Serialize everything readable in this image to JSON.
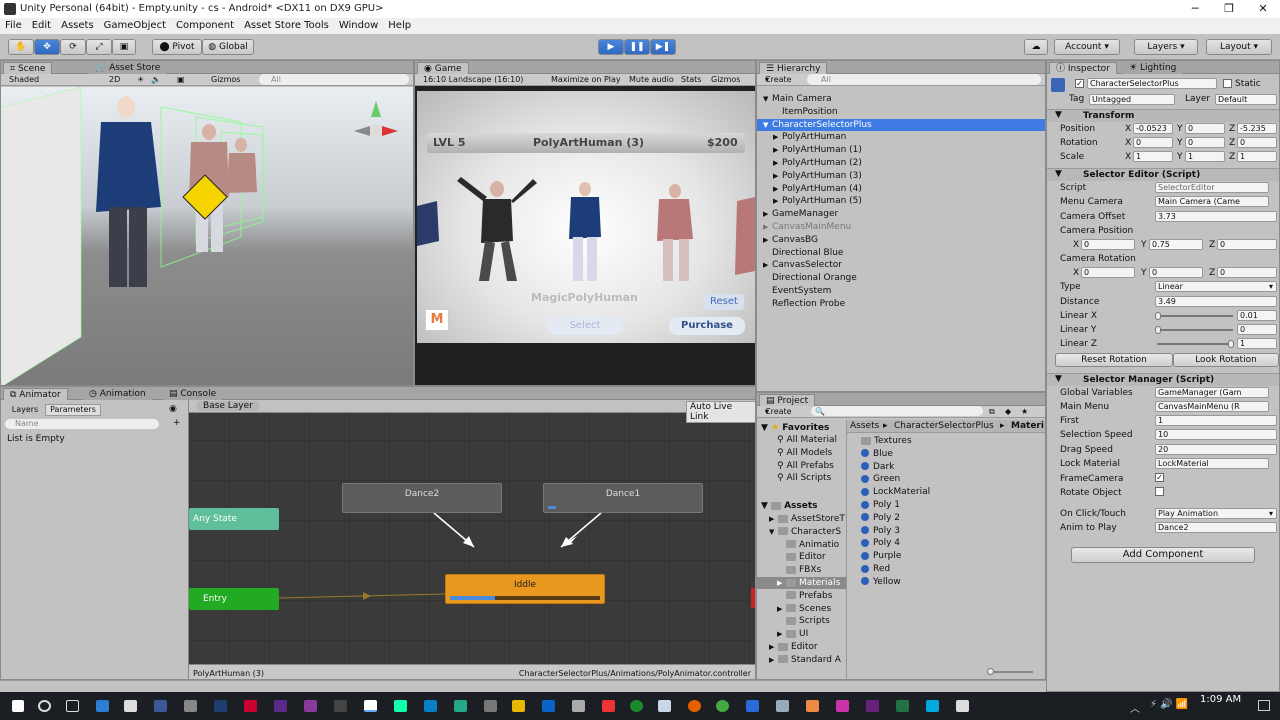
{
  "window": {
    "title": "Unity Personal (64bit) - Empty.unity - cs - Android* <DX11 on DX9 GPU>"
  },
  "menu": [
    "File",
    "Edit",
    "Assets",
    "GameObject",
    "Component",
    "Asset Store Tools",
    "Window",
    "Help"
  ],
  "toolbar": {
    "pivot": "Pivot",
    "global": "Global",
    "account": "Account",
    "layers": "Layers",
    "layout": "Layout"
  },
  "scene": {
    "tab": "Scene",
    "tab2": "Asset Store",
    "shading": "Shaded",
    "mode2d": "2D",
    "gizmos": "Gizmos",
    "search": "All"
  },
  "game": {
    "tab": "Game",
    "aspect": "16:10 Landscape (16:10)",
    "maximize": "Maximize on Play",
    "mute": "Mute audio",
    "stats": "Stats",
    "gizmos": "Gizmos",
    "lvl": "LVL 5",
    "char_name": "PolyArtHuman (3)",
    "money": "$200",
    "brand": "MagicPolyHuman",
    "reset": "Reset",
    "select": "Select",
    "purchase": "Purchase",
    "logo": "M"
  },
  "hierarchy": {
    "tab": "Hierarchy",
    "create": "Create",
    "search": "All",
    "items": [
      {
        "label": "Main Camera",
        "indent": 0,
        "arrow": "▼"
      },
      {
        "label": "ItemPosition",
        "indent": 1,
        "arrow": ""
      },
      {
        "label": "CharacterSelectorPlus",
        "indent": 0,
        "arrow": "▼",
        "selected": true
      },
      {
        "label": "PolyArtHuman",
        "indent": 1,
        "arrow": "▶"
      },
      {
        "label": "PolyArtHuman (1)",
        "indent": 1,
        "arrow": "▶"
      },
      {
        "label": "PolyArtHuman (2)",
        "indent": 1,
        "arrow": "▶"
      },
      {
        "label": "PolyArtHuman (3)",
        "indent": 1,
        "arrow": "▶"
      },
      {
        "label": "PolyArtHuman (4)",
        "indent": 1,
        "arrow": "▶"
      },
      {
        "label": "PolyArtHuman (5)",
        "indent": 1,
        "arrow": "▶"
      },
      {
        "label": "GameManager",
        "indent": 0,
        "arrow": "▶"
      },
      {
        "label": "CanvasMainMenu",
        "indent": 0,
        "arrow": "▶",
        "dim": true
      },
      {
        "label": "CanvasBG",
        "indent": 0,
        "arrow": "▶"
      },
      {
        "label": "Directional Blue",
        "indent": 0,
        "arrow": ""
      },
      {
        "label": "CanvasSelector",
        "indent": 0,
        "arrow": "▶"
      },
      {
        "label": "Directional Orange",
        "indent": 0,
        "arrow": ""
      },
      {
        "label": "EventSystem",
        "indent": 0,
        "arrow": ""
      },
      {
        "label": "Reflection Probe",
        "indent": 0,
        "arrow": ""
      }
    ]
  },
  "inspector": {
    "tab": "Inspector",
    "tab2": "Lighting",
    "name": "CharacterSelectorPlus",
    "static": "Static",
    "tag_label": "Tag",
    "tag": "Untagged",
    "layer_label": "Layer",
    "layer": "Default",
    "transform": {
      "title": "Transform",
      "position": "Position",
      "rotation": "Rotation",
      "scale": "Scale",
      "px": "-0.0523",
      "py": "0",
      "pz": "-5.235",
      "rx": "0",
      "ry": "0",
      "rz": "0",
      "sx": "1",
      "sy": "1",
      "sz": "1"
    },
    "selector_editor": {
      "title": "Selector Editor (Script)",
      "script_label": "Script",
      "script": "SelectorEditor",
      "menu_camera_label": "Menu Camera",
      "menu_camera": "Main Camera (Came",
      "camera_offset_label": "Camera Offset",
      "camera_offset": "3.73",
      "camera_position_label": "Camera Position",
      "cpx": "0",
      "cpy": "0.75",
      "cpz": "0",
      "camera_rotation_label": "Camera Rotation",
      "crx": "0",
      "cry": "0",
      "crz": "0",
      "type_label": "Type",
      "type": "Linear",
      "distance_label": "Distance",
      "distance": "3.49",
      "linear_x_label": "Linear X",
      "linear_x": "0.01",
      "linear_y_label": "Linear Y",
      "linear_y": "0",
      "linear_z_label": "Linear Z",
      "linear_z": "1",
      "reset_rotation": "Reset Rotation",
      "look_rotation": "Look Rotation"
    },
    "selector_manager": {
      "title": "Selector Manager (Script)",
      "global_vars_label": "Global Variables",
      "global_vars": "GameManager (Gam",
      "main_menu_label": "Main Menu",
      "main_menu": "CanvasMainMenu (R",
      "first_label": "First",
      "first": "1",
      "sel_speed_label": "Selection Speed",
      "sel_speed": "10",
      "drag_speed_label": "Drag Speed",
      "drag_speed": "20",
      "lock_mat_label": "Lock Material",
      "lock_mat": "LockMaterial",
      "frame_cam_label": "FrameCamera",
      "rotate_obj_label": "Rotate Object",
      "on_click_label": "On Click/Touch",
      "on_click": "Play Animation",
      "anim_label": "Anim to Play",
      "anim": "Dance2"
    },
    "add_component": "Add Component"
  },
  "animator": {
    "tab": "Animator",
    "tab2": "Animation",
    "tab3": "Console",
    "layers": "Layers",
    "parameters": "Parameters",
    "search": "Name",
    "empty": "List is Empty",
    "base_layer": "Base Layer",
    "auto_live": "Auto Live Link",
    "states": {
      "dance2": "Dance2",
      "dance1": "Dance1",
      "any": "Any State",
      "entry": "Entry",
      "iddle": "Iddle"
    },
    "footer_left": "PolyArtHuman (3)",
    "footer_right": "CharacterSelectorPlus/Animations/PolyAnimator.controller"
  },
  "project": {
    "tab": "Project",
    "create": "Create",
    "favorites": {
      "label": "Favorites",
      "items": [
        "All Material",
        "All Models",
        "All Prefabs",
        "All Scripts"
      ]
    },
    "assets_label": "Assets",
    "tree": [
      {
        "label": "AssetStoreT",
        "indent": 1,
        "arrow": "▶"
      },
      {
        "label": "CharacterS",
        "indent": 1,
        "arrow": "▼"
      },
      {
        "label": "Animatio",
        "indent": 2,
        "arrow": ""
      },
      {
        "label": "Editor",
        "indent": 2,
        "arrow": ""
      },
      {
        "label": "FBXs",
        "indent": 2,
        "arrow": ""
      },
      {
        "label": "Materials",
        "indent": 2,
        "arrow": "▶",
        "selected": true
      },
      {
        "label": "Prefabs",
        "indent": 2,
        "arrow": ""
      },
      {
        "label": "Scenes",
        "indent": 2,
        "arrow": "▶"
      },
      {
        "label": "Scripts",
        "indent": 2,
        "arrow": ""
      },
      {
        "label": "UI",
        "indent": 2,
        "arrow": "▶"
      },
      {
        "label": "Editor",
        "indent": 1,
        "arrow": "▶"
      },
      {
        "label": "Standard A",
        "indent": 1,
        "arrow": "▶"
      }
    ],
    "breadcrumb": [
      "Assets",
      "CharacterSelectorPlus",
      "Materi"
    ],
    "files": [
      "Textures",
      "Blue",
      "Dark",
      "Green",
      "LockMaterial",
      "Poly 1",
      "Poly 2",
      "Poly 3",
      "Poly 4",
      "Purple",
      "Red",
      "Yellow"
    ]
  },
  "taskbar": {
    "time": "1:09 AM"
  },
  "colors": {
    "accent": "#3d7bd9",
    "selected": "#3e7ce3",
    "entry": "#22aa22",
    "any_state": "#5fbf9a",
    "iddle": "#e8971f"
  }
}
